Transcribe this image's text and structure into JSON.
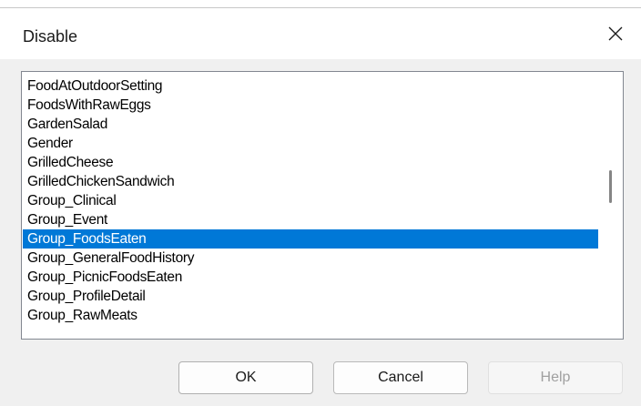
{
  "dialog": {
    "title": "Disable"
  },
  "list": {
    "items": [
      {
        "label": "FoodAtOutdoorSetting",
        "selected": false
      },
      {
        "label": "FoodsWithRawEggs",
        "selected": false
      },
      {
        "label": "GardenSalad",
        "selected": false
      },
      {
        "label": "Gender",
        "selected": false
      },
      {
        "label": "GrilledCheese",
        "selected": false
      },
      {
        "label": "GrilledChickenSandwich",
        "selected": false
      },
      {
        "label": "Group_Clinical",
        "selected": false
      },
      {
        "label": "Group_Event",
        "selected": false
      },
      {
        "label": "Group_FoodsEaten",
        "selected": true
      },
      {
        "label": "Group_GeneralFoodHistory",
        "selected": false
      },
      {
        "label": "Group_PicnicFoodsEaten",
        "selected": false
      },
      {
        "label": "Group_ProfileDetail",
        "selected": false
      },
      {
        "label": "Group_RawMeats",
        "selected": false
      }
    ]
  },
  "buttons": {
    "ok_label": "OK",
    "cancel_label": "Cancel",
    "help_label": "Help"
  },
  "icons": {
    "close": "close-icon"
  },
  "colors": {
    "selection": "#0078d7",
    "dialog_background": "#f0f0f0"
  }
}
